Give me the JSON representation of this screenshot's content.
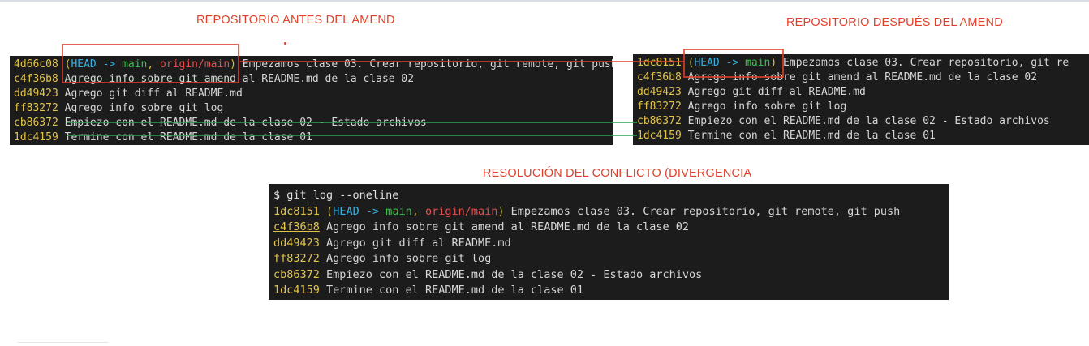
{
  "headings": {
    "before": "REPOSITORIO ANTES DEL AMEND",
    "after": "REPOSITORIO DESPUÉS DEL AMEND",
    "resolution": "RESOLUCIÓN DEL CONFLICTO (DIVERGENCIA"
  },
  "before": {
    "lines": [
      {
        "hash": "4d66c08",
        "head": "HEAD",
        "arrow": " -> ",
        "branch": "main",
        "sep": ", ",
        "origin": "origin/main",
        "msg": " Empezamos clase 03. Crear repositorio, git remote, git push"
      },
      {
        "hash": "c4f36b8",
        "msg": " Agrego info sobre git amend al README.md de la clase 02"
      },
      {
        "hash": "dd49423",
        "msg": " Agrego git diff al README.md"
      },
      {
        "hash": "ff83272",
        "msg": " Agrego info sobre git log"
      },
      {
        "hash": "cb86372",
        "msg": " Empiezo con el README.md de la clase 02 - Estado archivos"
      },
      {
        "hash": "1dc4159",
        "msg": " Termine con el README.md de la clase 01"
      }
    ]
  },
  "after": {
    "lines": [
      {
        "hash": "1dc8151",
        "head": "HEAD",
        "arrow": " -> ",
        "branch": "main",
        "msg": " Empezamos clase 03. Crear repositorio, git re"
      },
      {
        "hash": "c4f36b8",
        "msg": " Agrego info sobre git amend al README.md de la clase 02"
      },
      {
        "hash": "dd49423",
        "msg": " Agrego git diff al README.md"
      },
      {
        "hash": "ff83272",
        "msg": " Agrego info sobre git log"
      },
      {
        "hash": "cb86372",
        "msg": " Empiezo con el README.md de la clase 02 - Estado archivos"
      },
      {
        "hash": "1dc4159",
        "msg": " Termine con el README.md de la clase 01"
      }
    ]
  },
  "resolution": {
    "command": "$ git log --oneline",
    "lines": [
      {
        "hash": "1dc8151",
        "head": "HEAD",
        "arrow": " -> ",
        "branch": "main",
        "sep": ", ",
        "origin": "origin/main",
        "msg": " Empezamos clase 03. Crear repositorio, git remote, git push"
      },
      {
        "hash": "c4f36b8",
        "msg": " Agrego info sobre git amend al README.md de la clase 02"
      },
      {
        "hash": "dd49423",
        "msg": " Agrego git diff al README.md"
      },
      {
        "hash": "ff83272",
        "msg": " Agrego info sobre git log"
      },
      {
        "hash": "cb86372",
        "msg": " Empiezo con el README.md de la clase 02 - Estado archivos"
      },
      {
        "hash": "1dc4159",
        "msg": " Termine con el README.md de la clase 01"
      }
    ]
  },
  "colors": {
    "annotation_red": "#e0402a",
    "connector_green": "#2f9e5a",
    "terminal_bg": "#1c1c1c",
    "hash_yellow": "#e3c44a",
    "head_blue": "#36b0e3",
    "branch_green": "#36c34a",
    "origin_red": "#e05050"
  }
}
